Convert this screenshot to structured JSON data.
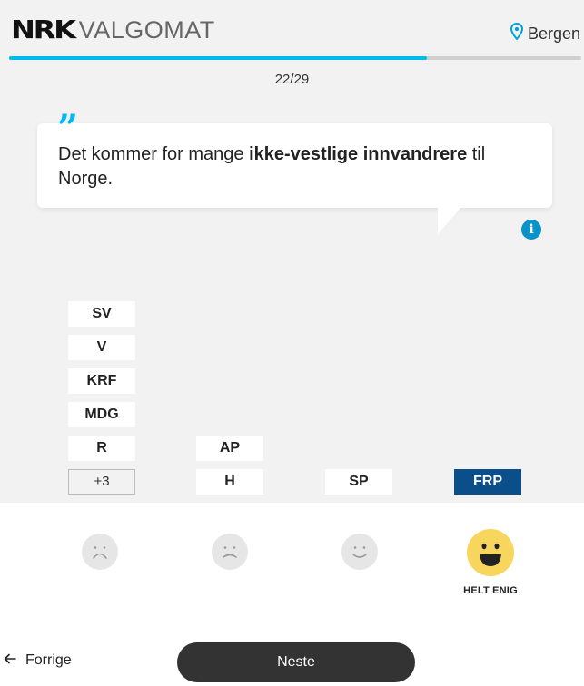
{
  "header": {
    "logo_mark": "NRK",
    "logo_text": "VALGOMAT",
    "location": "Bergen"
  },
  "progress": {
    "current": 22,
    "total": 29,
    "label": "22/29",
    "fill_fraction": 0.73
  },
  "statement": {
    "before": "Det kommer for mange ",
    "highlight": "ikke-vestlige innvandrere",
    "after": " til Norge."
  },
  "columns": [
    {
      "parties": [
        "SV",
        "V",
        "KRF",
        "MDG",
        "R"
      ],
      "more": "+3"
    },
    {
      "parties": [
        "AP",
        "H"
      ]
    },
    {
      "parties": [
        "SP"
      ]
    },
    {
      "parties": [
        "FRP"
      ],
      "selected": "FRP"
    }
  ],
  "answers": {
    "options": [
      "sad-face-icon",
      "frown-face-icon",
      "smile-face-icon",
      "grin-face-icon"
    ],
    "selected_label": "HELT ENIG"
  },
  "nav": {
    "prev_label": "Forrige",
    "next_label": "Neste"
  },
  "colors": {
    "accent": "#00b9f2",
    "party_selected": "#0b4f8a",
    "face_active": "#f8d55d",
    "button_dark": "#333333"
  }
}
